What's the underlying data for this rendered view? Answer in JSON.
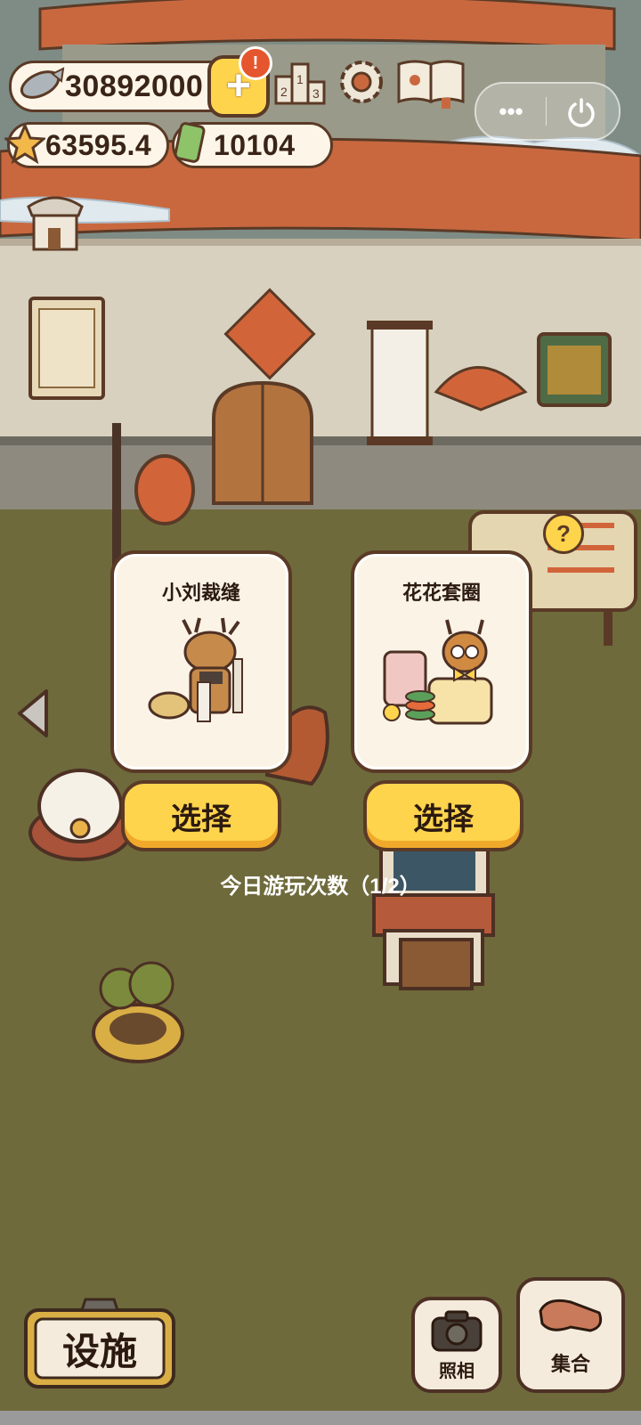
{
  "currencies": {
    "fish": "30892000",
    "star": "63595.4",
    "ticket": "10104"
  },
  "notification_badge": "!",
  "wechat_capsule": {
    "more": "•••"
  },
  "cards": [
    {
      "title": "小刘裁缝",
      "button": "选择"
    },
    {
      "title": "花花套圈",
      "button": "选择"
    }
  ],
  "play_count": "今日游玩次数（1/2）",
  "help_badge": "?",
  "bottom": {
    "facility": "设施",
    "photo": "照相",
    "gather": "集合"
  },
  "colors": {
    "accent_yellow": "#ffd44d",
    "outline_brown": "#5a3a26",
    "roof_orange": "#c9683f",
    "ground_olive": "#6e6a3c"
  }
}
